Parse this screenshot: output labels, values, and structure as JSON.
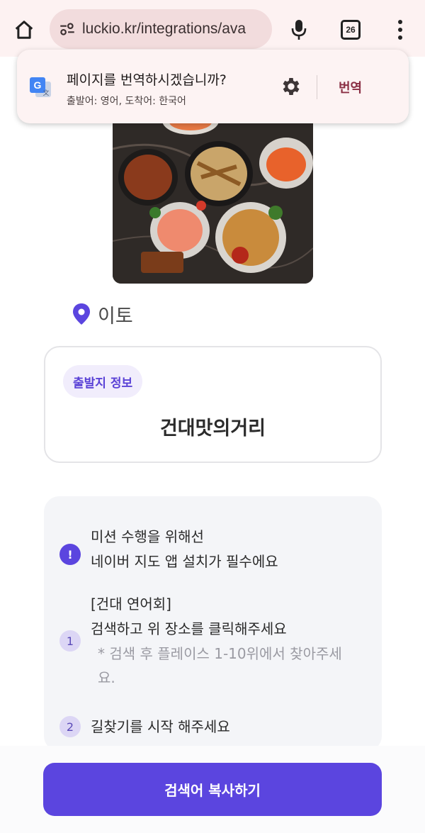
{
  "browser": {
    "url": "luckio.kr/integrations/ava",
    "tab_count": "26",
    "icons": [
      "home-icon",
      "site-settings-icon",
      "mic-icon",
      "tabs-icon",
      "more-vert-icon"
    ]
  },
  "translate_bar": {
    "title": "페이지를 번역하시겠습니까?",
    "subtitle": "출발어: 영어, 도착어: 한국어",
    "action_label": "번역",
    "icons": [
      "google-translate-icon",
      "gear-icon"
    ]
  },
  "place": {
    "name": "이토",
    "image_icon": "food-photo",
    "pin_color": "#5b45df"
  },
  "departure": {
    "badge": "출발지 정보",
    "name": "건대맛의거리"
  },
  "mission": {
    "notice_icon": "!",
    "notice_lines": [
      "미션 수행을 위해선",
      "네이버 지도 앱 설치가 필수에요"
    ],
    "steps": [
      {
        "number": "1",
        "lines": [
          "[건대 연어회]",
          "검색하고 위 장소를 클릭해주세요"
        ],
        "note_lines": [
          "* 검색 후 플레이스 1-10위에서 찾아주세",
          "요."
        ]
      },
      {
        "number": "2",
        "lines": [
          "길찾기를 시작 해주세요"
        ]
      }
    ]
  },
  "cta": {
    "label": "검색어 복사하기"
  },
  "colors": {
    "accent": "#5b45df",
    "badge_bg": "#f1edfc",
    "info_bg": "#f4f5f8"
  }
}
